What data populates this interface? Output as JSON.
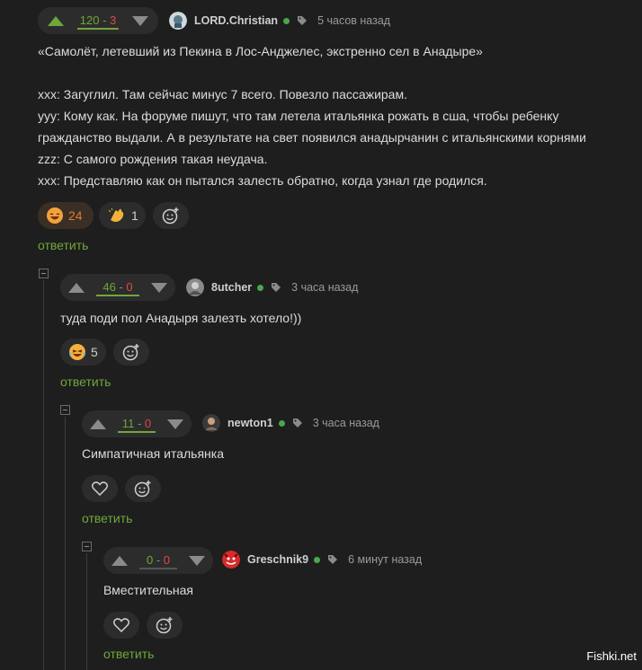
{
  "comments": [
    {
      "score_plus": "120",
      "score_sep": " - ",
      "score_minus": "3",
      "plus_fraction": 0.976,
      "author": "LORD.Christian",
      "time": "5 часов назад",
      "lines": [
        "«Самолёт, летевший из Пекина в Лос-Анджелес, экстренно сел в Анадыре»",
        "",
        "xxx: Загуглил. Там сейчас минус 7 всего. Повезло пассажирам.",
        "yyy: Кому как. На форуме пишут, что там летела итальянка рожать в сша, чтобы ребенку",
        "гражданство выдали. А в результате на свет появился анадырчанин с итальянскими корнями",
        "zzz: С самого рождения такая неудача.",
        "xxx: Представляю как он пытался залесть обратно, когда узнал где родился."
      ],
      "reactions": [
        {
          "icon": "laughing-face-icon",
          "count": "24"
        },
        {
          "icon": "clapping-hands-icon",
          "count": "1"
        }
      ],
      "reply": "ответить"
    },
    {
      "score_plus": "46",
      "score_sep": " - ",
      "score_minus": "0",
      "plus_fraction": 1.0,
      "author": "8utcher",
      "time": "3 часа назад",
      "text": "туда поди пол Анадыря залезть хотело!))",
      "reactions": [
        {
          "icon": "laughing-tears-face-icon",
          "count": "5"
        }
      ],
      "reply": "ответить"
    },
    {
      "score_plus": "11",
      "score_sep": " - ",
      "score_minus": "0",
      "plus_fraction": 1.0,
      "author": "newton1",
      "time": "3 часа назад",
      "text": "Симпатичная итальянка",
      "reply": "ответить"
    },
    {
      "score_plus": "0",
      "score_sep": " - ",
      "score_minus": "0",
      "plus_fraction": 0,
      "author": "Greschnik9",
      "time": "6 минут назад",
      "text": "Вместительная",
      "reply": "ответить"
    }
  ],
  "watermark": "Fishki.net",
  "colors": {
    "background": "#1e1e1e",
    "plus": "#6fa83a",
    "minus": "#e04848",
    "online": "#4aa84a",
    "reply": "#6fa83a"
  }
}
